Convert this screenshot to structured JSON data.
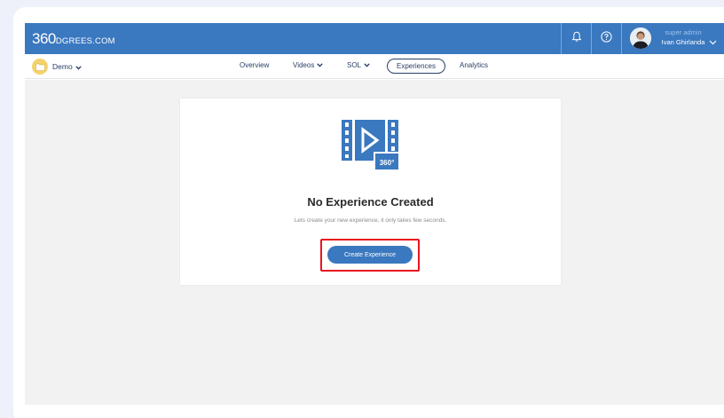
{
  "header": {
    "logo_big": "360",
    "logo_small": "DGREES.COM",
    "user_role": "super admin",
    "user_name": "Ivan Ghirlanda"
  },
  "subnav": {
    "project_name": "Demo",
    "items": [
      {
        "label": "Overview"
      },
      {
        "label": "Videos"
      },
      {
        "label": "SOL"
      },
      {
        "label": "Experiences"
      },
      {
        "label": "Analytics"
      }
    ],
    "active": "Experiences"
  },
  "empty_state": {
    "title": "No Experience Created",
    "subtitle": "Lets create your new experience, it only takes few seconds.",
    "badge": "360°",
    "button_label": "Create Experience"
  },
  "colors": {
    "brand": "#3a78bf",
    "nav_text": "#2a3f66",
    "highlight": "#e8141f"
  }
}
